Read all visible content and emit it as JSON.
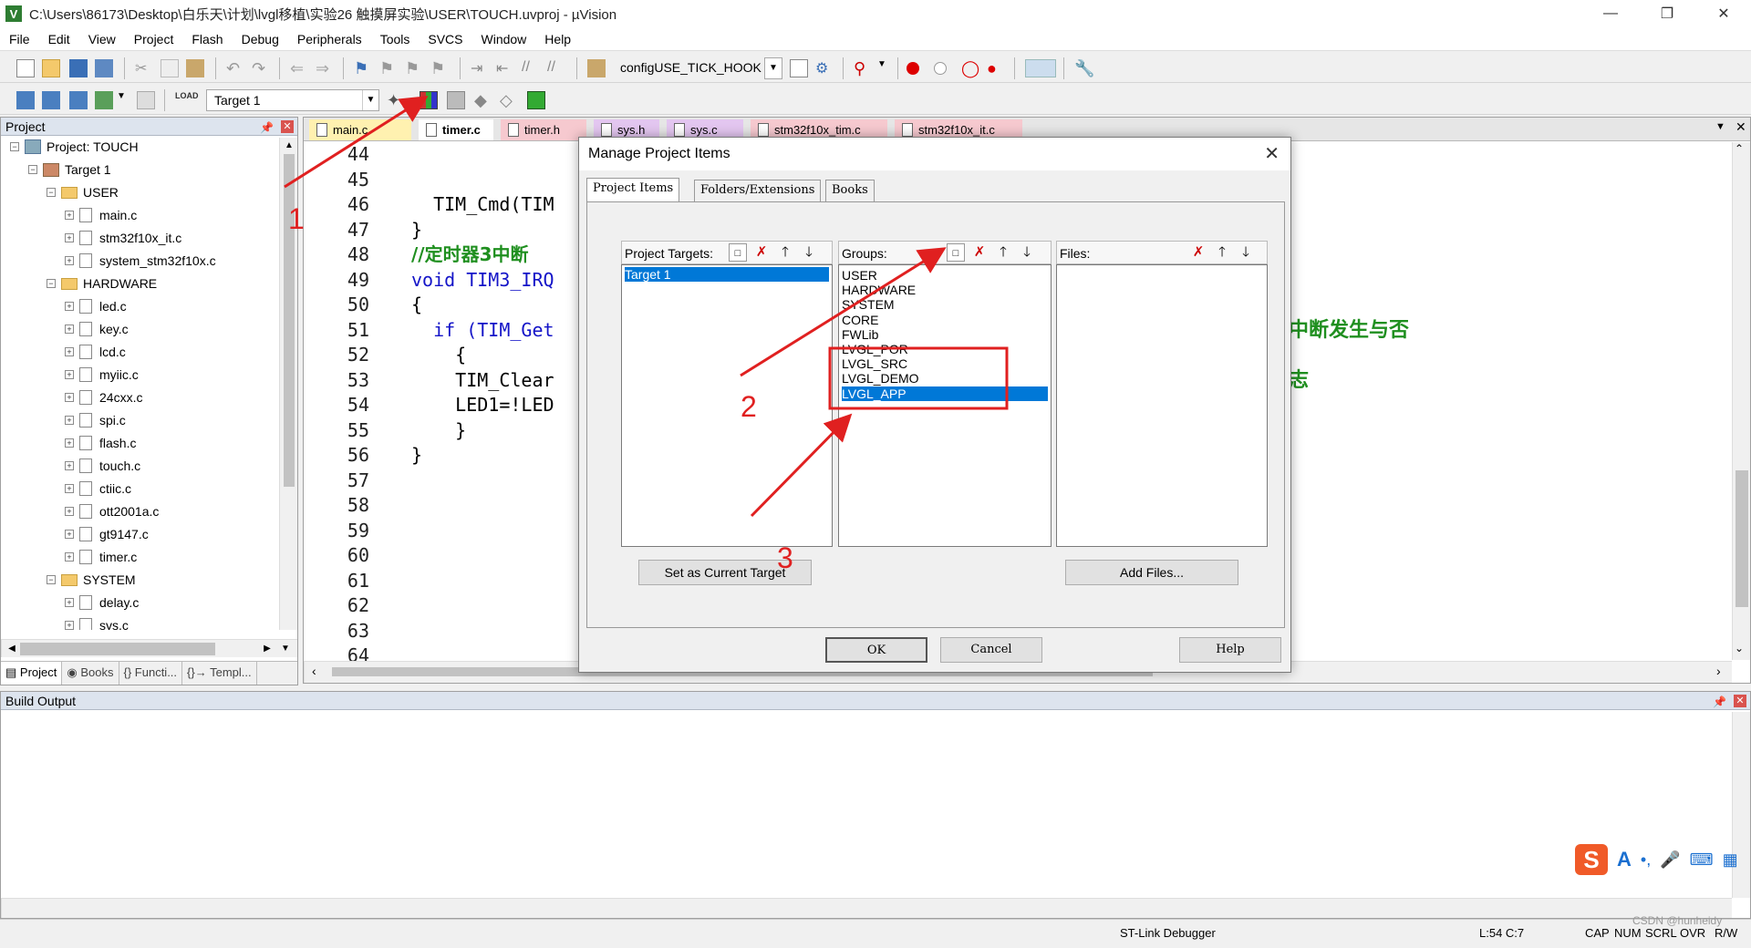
{
  "window": {
    "title": "C:\\Users\\86173\\Desktop\\白乐天\\计划\\lvgl移植\\实验26 触摸屏实验\\USER\\TOUCH.uvproj - µVision"
  },
  "menu": [
    "File",
    "Edit",
    "View",
    "Project",
    "Flash",
    "Debug",
    "Peripherals",
    "Tools",
    "SVCS",
    "Window",
    "Help"
  ],
  "toolbar1": {
    "config_combo": "configUSE_TICK_HOOK"
  },
  "toolbar2": {
    "load_label": "LOAD",
    "target_combo": "Target 1"
  },
  "project_panel": {
    "title": "Project",
    "tree": [
      {
        "label": "Project: TOUCH",
        "indent": 0,
        "kind": "project"
      },
      {
        "label": "Target 1",
        "indent": 1,
        "kind": "target"
      },
      {
        "label": "USER",
        "indent": 2,
        "kind": "folder"
      },
      {
        "label": "main.c",
        "indent": 3,
        "kind": "file"
      },
      {
        "label": "stm32f10x_it.c",
        "indent": 3,
        "kind": "file"
      },
      {
        "label": "system_stm32f10x.c",
        "indent": 3,
        "kind": "file"
      },
      {
        "label": "HARDWARE",
        "indent": 2,
        "kind": "folder"
      },
      {
        "label": "led.c",
        "indent": 3,
        "kind": "file"
      },
      {
        "label": "key.c",
        "indent": 3,
        "kind": "file"
      },
      {
        "label": "lcd.c",
        "indent": 3,
        "kind": "file"
      },
      {
        "label": "myiic.c",
        "indent": 3,
        "kind": "file"
      },
      {
        "label": "24cxx.c",
        "indent": 3,
        "kind": "file"
      },
      {
        "label": "spi.c",
        "indent": 3,
        "kind": "file"
      },
      {
        "label": "flash.c",
        "indent": 3,
        "kind": "file"
      },
      {
        "label": "touch.c",
        "indent": 3,
        "kind": "file"
      },
      {
        "label": "ctiic.c",
        "indent": 3,
        "kind": "file"
      },
      {
        "label": "ott2001a.c",
        "indent": 3,
        "kind": "file"
      },
      {
        "label": "gt9147.c",
        "indent": 3,
        "kind": "file"
      },
      {
        "label": "timer.c",
        "indent": 3,
        "kind": "file"
      },
      {
        "label": "SYSTEM",
        "indent": 2,
        "kind": "folder"
      },
      {
        "label": "delay.c",
        "indent": 3,
        "kind": "file"
      },
      {
        "label": "sys.c",
        "indent": 3,
        "kind": "file"
      }
    ],
    "tabs": [
      "Project",
      "Books",
      "{} Functi...",
      "{}→ Templ..."
    ]
  },
  "editor": {
    "tabs": [
      {
        "label": "main.c",
        "color": "#fff1b0"
      },
      {
        "label": "timer.c",
        "color": "#fff1b0"
      },
      {
        "label": "timer.h",
        "color": "#f6c9cf"
      },
      {
        "label": "sys.h",
        "color": "#e3c6f0"
      },
      {
        "label": "sys.c",
        "color": "#e3c6f0"
      },
      {
        "label": "stm32f10x_tim.c",
        "color": "#f6c9cf"
      },
      {
        "label": "stm32f10x_it.c",
        "color": "#f6c9cf"
      }
    ],
    "line_numbers": [
      "44",
      "45",
      "46",
      "47",
      "48",
      "49",
      "50",
      "51",
      "52",
      "53",
      "54",
      "55",
      "56",
      "57",
      "58",
      "59",
      "60",
      "61",
      "62",
      "63",
      "64"
    ],
    "code": [
      {
        "text": "",
        "cls": ""
      },
      {
        "text": "",
        "cls": ""
      },
      {
        "text": "  TIM_Cmd(TIM",
        "cls": ""
      },
      {
        "text": "}",
        "cls": ""
      },
      {
        "text": "//定时器3中断",
        "cls": "cmt"
      },
      {
        "text": "void TIM3_IRQ",
        "cls": "kw"
      },
      {
        "text": "{",
        "cls": ""
      },
      {
        "text": "  if (TIM_Get",
        "cls": "kw"
      },
      {
        "text": "    {",
        "cls": ""
      },
      {
        "text": "    TIM_Clear",
        "cls": ""
      },
      {
        "text": "    LED1=!LED",
        "cls": ""
      },
      {
        "text": "    }",
        "cls": ""
      },
      {
        "text": "}",
        "cls": ""
      }
    ],
    "right_comment1": "中断发生与否",
    "right_comment2": "志"
  },
  "dialog": {
    "title": "Manage Project Items",
    "tabs": [
      "Project Items",
      "Folders/Extensions",
      "Books"
    ],
    "targets_label": "Project Targets:",
    "groups_label": "Groups:",
    "files_label": "Files:",
    "targets": [
      "Target 1"
    ],
    "groups": [
      "USER",
      "HARDWARE",
      "SYSTEM",
      "CORE",
      "FWLib",
      "LVGL_POR",
      "LVGL_SRC",
      "LVGL_DEMO",
      "LVGL_APP"
    ],
    "selected_group": 8,
    "set_target_btn": "Set as Current Target",
    "add_files_btn": "Add Files...",
    "ok_btn": "OK",
    "cancel_btn": "Cancel",
    "help_btn": "Help"
  },
  "annotations": [
    "1",
    "2",
    "3"
  ],
  "build_output": {
    "title": "Build Output"
  },
  "status": {
    "debugger": "ST-Link Debugger",
    "position": "L:54 C:7",
    "caps": "CAP",
    "num": "NUM",
    "scrl": "SCRL",
    "ovr": "OVR",
    "rw": "R/W",
    "watermark": "CSDN @hunheidy"
  },
  "ime": {
    "lang": "A"
  },
  "colors": {
    "accent": "#0078d7",
    "annotation": "#e02020",
    "comment": "#1f8f1f",
    "keyword": "#1414c8"
  }
}
